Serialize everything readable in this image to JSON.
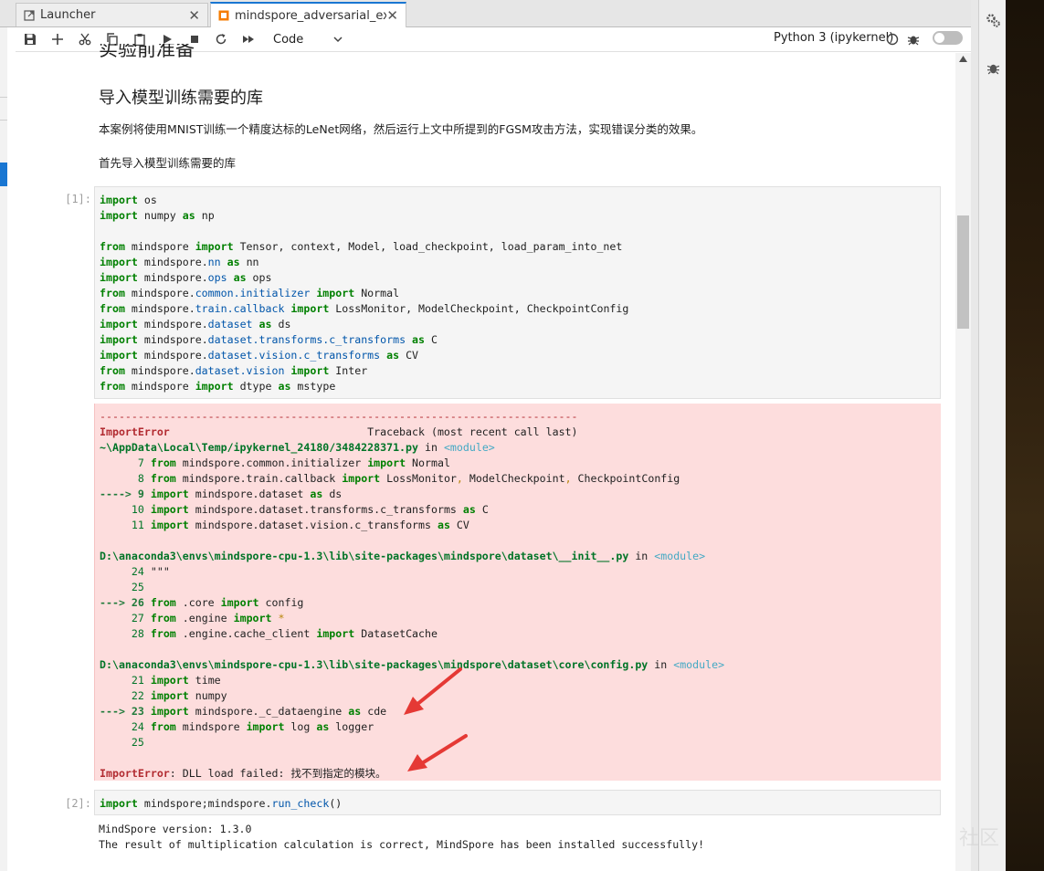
{
  "tabs": [
    {
      "label": "Launcher",
      "icon": "launcher-icon",
      "active": false
    },
    {
      "label": "mindspore_adversarial_exam",
      "icon": "notebook-icon",
      "active": true
    }
  ],
  "toolbar": {
    "cell_type": "Code",
    "kernel_name": "Python 3 (ipykernel)"
  },
  "markdown": {
    "partial_heading": "实验前准备",
    "heading": "导入模型训练需要的库",
    "paragraph1": "本案例将使用MNIST训练一个精度达标的LeNet网络，然后运行上文中所提到的FGSM攻击方法，实现错误分类的效果。",
    "paragraph2": "首先导入模型训练需要的库"
  },
  "cells": [
    {
      "prompt": "[1]:"
    },
    {
      "prompt": "[2]:",
      "output": [
        "MindSpore version: 1.3.0",
        "The result of multiplication calculation is correct, MindSpore has been installed successfully!"
      ]
    }
  ],
  "watermark": "社区",
  "colors": {
    "accent": "#1976d2",
    "error_bg": "#fddddd",
    "keyword": "#008000",
    "annotation_arrow": "#e53935"
  }
}
